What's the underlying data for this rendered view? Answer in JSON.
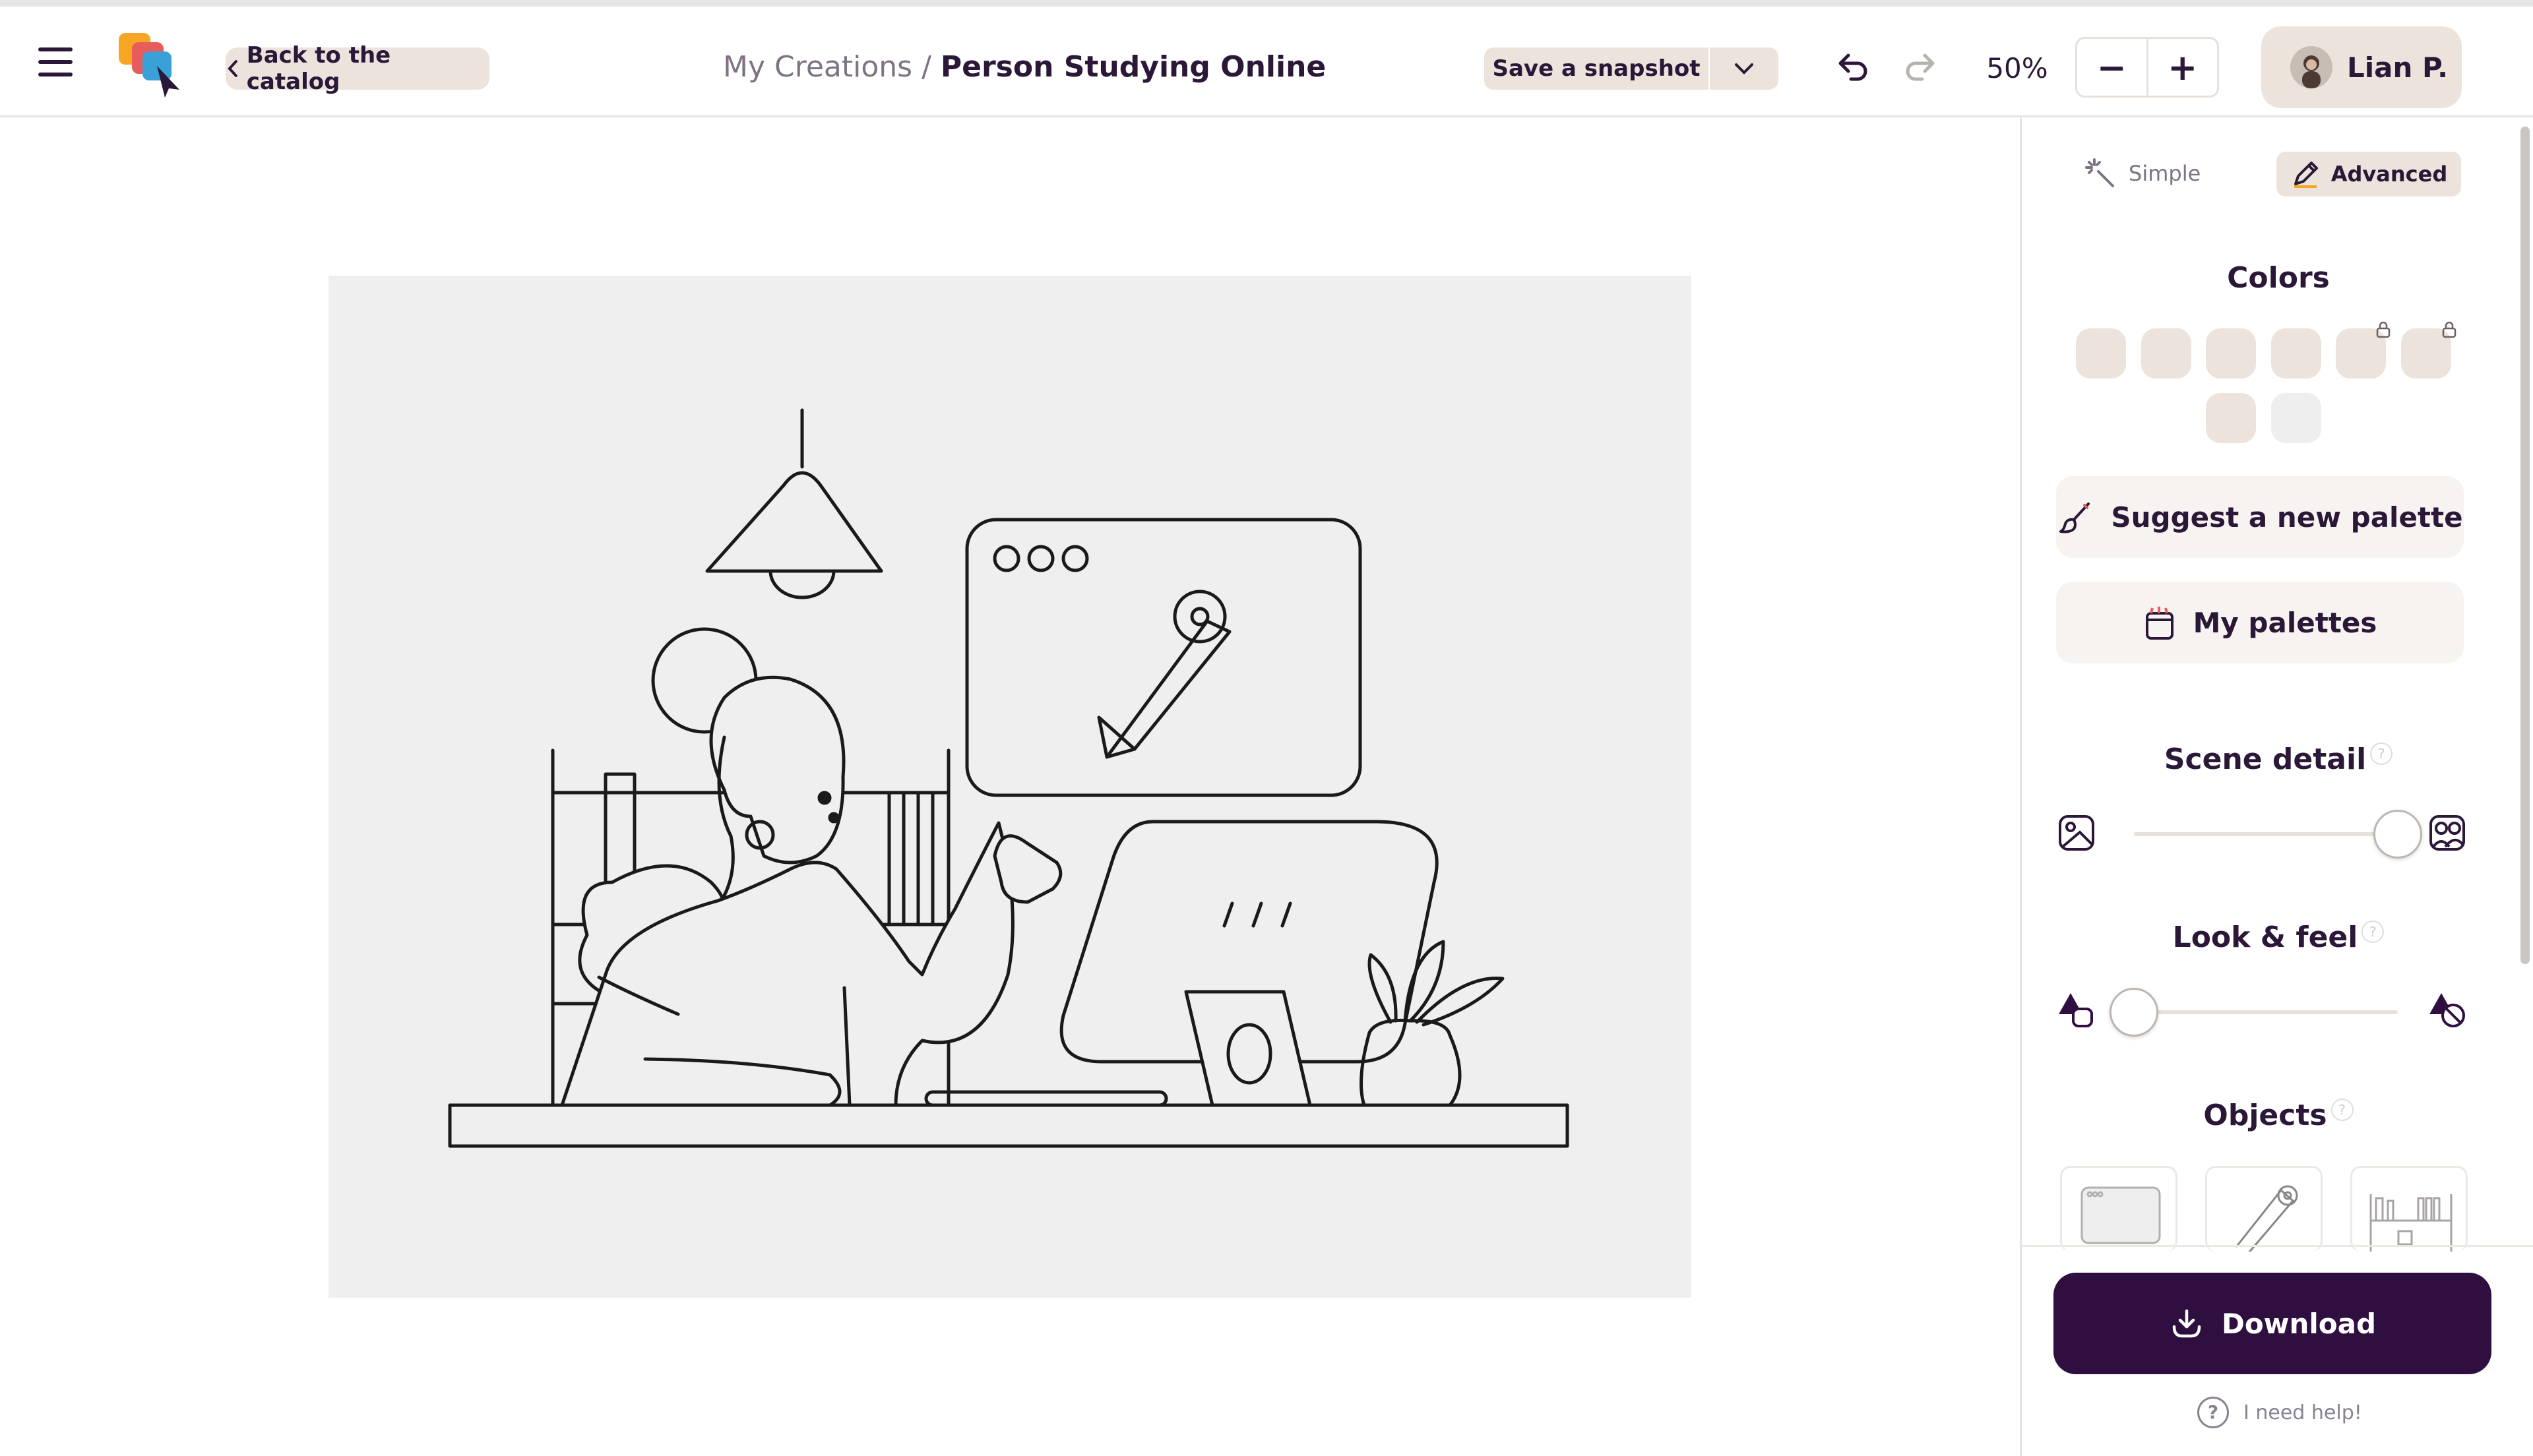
{
  "header": {
    "back_label": "Back to the catalog",
    "breadcrumb_parent": "My Creations",
    "breadcrumb_separator": " / ",
    "breadcrumb_current": "Person Studying Online",
    "snapshot_label": "Save a snapshot",
    "zoom_level": "50%",
    "zoom_out_symbol": "−",
    "zoom_in_symbol": "+",
    "user_name": "Lian P."
  },
  "panel": {
    "mode_simple": "Simple",
    "mode_advanced": "Advanced",
    "colors_title": "Colors",
    "suggest_palette": "Suggest a new palette",
    "my_palettes": "My palettes",
    "scene_detail_title": "Scene detail",
    "scene_detail_value": 1.0,
    "look_feel_title": "Look & feel",
    "look_feel_value": 0.0,
    "objects_title": "Objects",
    "download_label": "Download",
    "help_label": "I need help!"
  },
  "colors": {
    "swatch": "#ebe3dc",
    "swatch_light": "#eeeeef",
    "accent_dark": "#2f0f40",
    "text": "#2b1838",
    "artboard_bg": "#efeff0"
  },
  "icons": [
    "menu-icon",
    "logo",
    "chevron-left-icon",
    "chevron-down-icon",
    "undo-icon",
    "redo-icon",
    "magic-wand-icon",
    "pencil-icon",
    "lock-icon",
    "brush-icon",
    "folder-icon",
    "image-simple-icon",
    "image-detailed-icon",
    "shapes-filled-icon",
    "shapes-outline-icon",
    "download-icon",
    "help-icon"
  ]
}
